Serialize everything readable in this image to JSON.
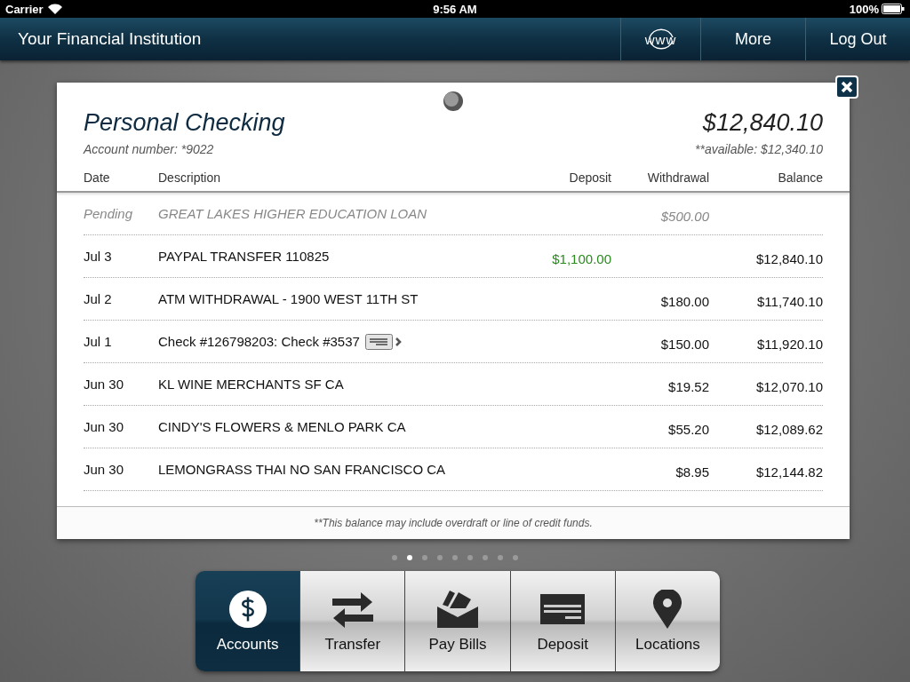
{
  "status_bar": {
    "carrier": "Carrier",
    "time": "9:56 AM",
    "battery": "100%"
  },
  "nav": {
    "title": "Your Financial Institution",
    "buttons": [
      {
        "kind": "web",
        "label": "www"
      },
      {
        "kind": "text",
        "label": "More"
      },
      {
        "kind": "text",
        "label": "Log Out"
      }
    ]
  },
  "account": {
    "name": "Personal Checking",
    "number": "Account number: *9022",
    "balance": "$12,840.10",
    "available": "**available: $12,340.10"
  },
  "table": {
    "columns": [
      "Date",
      "Description",
      "Deposit",
      "Withdrawal",
      "Balance"
    ],
    "rows": [
      {
        "kind": "pending",
        "date": "Pending",
        "description": "GREAT LAKES HIGHER EDUCATION LOAN",
        "deposit": "",
        "withdrawal": "$500.00",
        "balance": "",
        "has_check_image": false
      },
      {
        "kind": "posted",
        "date": "Jul 3",
        "description": "PAYPAL TRANSFER 110825",
        "deposit": "$1,100.00",
        "withdrawal": "",
        "balance": "$12,840.10",
        "has_check_image": false
      },
      {
        "kind": "posted",
        "date": "Jul 2",
        "description": "ATM WITHDRAWAL - 1900 WEST 11TH ST",
        "deposit": "",
        "withdrawal": "$180.00",
        "balance": "$11,740.10",
        "has_check_image": false
      },
      {
        "kind": "posted",
        "date": "Jul 1",
        "description": "Check #126798203: Check #3537",
        "deposit": "",
        "withdrawal": "$150.00",
        "balance": "$11,920.10",
        "has_check_image": true
      },
      {
        "kind": "posted",
        "date": "Jun 30",
        "description": "KL WINE MERCHANTS SF CA",
        "deposit": "",
        "withdrawal": "$19.52",
        "balance": "$12,070.10",
        "has_check_image": false
      },
      {
        "kind": "posted",
        "date": "Jun 30",
        "description": "CINDY'S FLOWERS & MENLO PARK CA",
        "deposit": "",
        "withdrawal": "$55.20",
        "balance": "$12,089.62",
        "has_check_image": false
      },
      {
        "kind": "posted",
        "date": "Jun 30",
        "description": "LEMONGRASS THAI NO SAN FRANCISCO CA",
        "deposit": "",
        "withdrawal": "$8.95",
        "balance": "$12,144.82",
        "has_check_image": false
      }
    ]
  },
  "footnote": "**This balance may include overdraft or line of credit funds.",
  "pages": [
    {
      "selected": false
    },
    {
      "selected": true
    },
    {
      "selected": false
    },
    {
      "selected": false
    },
    {
      "selected": false
    },
    {
      "selected": false
    },
    {
      "selected": false
    },
    {
      "selected": false
    },
    {
      "selected": false
    }
  ],
  "tabs": [
    {
      "kind": "accounts",
      "label": "Accounts",
      "selected": true
    },
    {
      "kind": "transfer",
      "label": "Transfer",
      "selected": false
    },
    {
      "kind": "paybills",
      "label": "Pay Bills",
      "selected": false
    },
    {
      "kind": "deposit",
      "label": "Deposit",
      "selected": false
    },
    {
      "kind": "locations",
      "label": "Locations",
      "selected": false
    }
  ]
}
